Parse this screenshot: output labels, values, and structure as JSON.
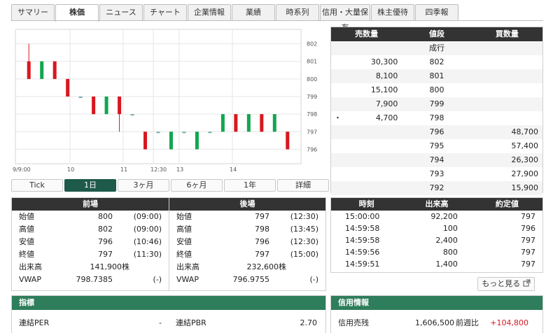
{
  "tabs": [
    "サマリー",
    "株価",
    "ニュース",
    "チャート",
    "企業情報",
    "業績",
    "時系列",
    "信用・大量保有",
    "株主優待",
    "四季報"
  ],
  "active_tab": "株価",
  "chart_data": {
    "type": "candlestick",
    "y_ticks": [
      "802",
      "801",
      "800",
      "799",
      "798",
      "797",
      "796"
    ],
    "ylim": [
      795.5,
      802.5
    ],
    "x_labels": [
      "9/9:00",
      "10",
      "11",
      "12:30",
      "13",
      "14"
    ],
    "up_color": "#12a650",
    "down_color": "#d8171f",
    "candles": [
      {
        "o": 801,
        "c": 800,
        "h": 802,
        "l": 800
      },
      {
        "o": 800,
        "c": 801,
        "h": 801,
        "l": 800
      },
      {
        "o": 801,
        "c": 800,
        "h": 801,
        "l": 800
      },
      {
        "o": 800,
        "c": 799,
        "h": 800,
        "l": 799
      },
      {
        "o": 799,
        "c": 799,
        "h": 799,
        "l": 799
      },
      {
        "o": 799,
        "c": 798,
        "h": 799,
        "l": 798
      },
      {
        "o": 798,
        "c": 799,
        "h": 799,
        "l": 798
      },
      {
        "o": 799,
        "c": 798,
        "h": 799,
        "l": 797
      },
      {
        "o": 798,
        "c": 798,
        "h": 798,
        "l": 798
      },
      {
        "o": 797,
        "c": 796,
        "h": 797,
        "l": 796
      },
      {
        "o": 797,
        "c": 797,
        "h": 797,
        "l": 797
      },
      {
        "o": 796,
        "c": 797,
        "h": 797,
        "l": 796
      },
      {
        "o": 797,
        "c": 797,
        "h": 797,
        "l": 797
      },
      {
        "o": 796,
        "c": 797,
        "h": 797,
        "l": 796
      },
      {
        "o": 797,
        "c": 797,
        "h": 797,
        "l": 797
      },
      {
        "o": 797,
        "c": 798,
        "h": 798,
        "l": 797
      },
      {
        "o": 798,
        "c": 797,
        "h": 798,
        "l": 797
      },
      {
        "o": 797,
        "c": 798,
        "h": 798,
        "l": 797
      },
      {
        "o": 798,
        "c": 797,
        "h": 798,
        "l": 797
      },
      {
        "o": 797,
        "c": 798,
        "h": 798,
        "l": 797
      },
      {
        "o": 797,
        "c": 796,
        "h": 797,
        "l": 796
      }
    ]
  },
  "ranges": [
    "Tick",
    "1日",
    "3ヶ月",
    "6ヶ月",
    "1年",
    "詳細"
  ],
  "active_range": "1日",
  "session": {
    "morning": {
      "title": "前場",
      "rows": [
        {
          "label": "始値",
          "value": "800",
          "time": "(09:00)"
        },
        {
          "label": "高値",
          "value": "802",
          "time": "(09:00)"
        },
        {
          "label": "安値",
          "value": "796",
          "time": "(10:46)"
        },
        {
          "label": "終値",
          "value": "797",
          "time": "(11:30)"
        },
        {
          "label": "出来高",
          "value": "141,900株",
          "time": ""
        },
        {
          "label": "VWAP",
          "value": "798.7385",
          "time": "(-)"
        }
      ]
    },
    "afternoon": {
      "title": "後場",
      "rows": [
        {
          "label": "始値",
          "value": "797",
          "time": "(12:30)"
        },
        {
          "label": "高値",
          "value": "798",
          "time": "(13:45)"
        },
        {
          "label": "安値",
          "value": "796",
          "time": "(12:30)"
        },
        {
          "label": "終値",
          "value": "797",
          "time": "(15:00)"
        },
        {
          "label": "出来高",
          "value": "232,600株",
          "time": ""
        },
        {
          "label": "VWAP",
          "value": "796.9755",
          "time": "(-)"
        }
      ]
    }
  },
  "board": {
    "headers": [
      "売数量",
      "値段",
      "買数量"
    ],
    "rows": [
      {
        "sell": "",
        "price": "成行",
        "buy": "",
        "mark": ""
      },
      {
        "sell": "30,300",
        "price": "802",
        "buy": "",
        "mark": ""
      },
      {
        "sell": "8,100",
        "price": "801",
        "buy": "",
        "mark": ""
      },
      {
        "sell": "15,100",
        "price": "800",
        "buy": "",
        "mark": ""
      },
      {
        "sell": "7,900",
        "price": "799",
        "buy": "",
        "mark": ""
      },
      {
        "sell": "4,700",
        "price": "798",
        "buy": "",
        "mark": "・"
      },
      {
        "sell": "",
        "price": "796",
        "buy": "48,700",
        "mark": ""
      },
      {
        "sell": "",
        "price": "795",
        "buy": "57,400",
        "mark": ""
      },
      {
        "sell": "",
        "price": "794",
        "buy": "26,300",
        "mark": ""
      },
      {
        "sell": "",
        "price": "793",
        "buy": "27,900",
        "mark": ""
      },
      {
        "sell": "",
        "price": "792",
        "buy": "15,900",
        "mark": ""
      }
    ]
  },
  "ticks": {
    "headers": [
      "時刻",
      "出来高",
      "約定値"
    ],
    "rows": [
      {
        "time": "15:00:00",
        "volume": "92,200",
        "price": "797"
      },
      {
        "time": "14:59:58",
        "volume": "100",
        "price": "796"
      },
      {
        "time": "14:59:58",
        "volume": "2,400",
        "price": "797"
      },
      {
        "time": "14:59:56",
        "volume": "800",
        "price": "797"
      },
      {
        "time": "14:59:51",
        "volume": "1,400",
        "price": "797"
      }
    ],
    "more_label": "もっと見る"
  },
  "indicators": {
    "title": "指標",
    "per_label": "連結PER",
    "per_value": "-",
    "pbr_label": "連結PBR",
    "pbr_value": "2.70"
  },
  "credit": {
    "title": "信用情報",
    "label": "信用売残",
    "value": "1,606,500",
    "change_label": "前週比",
    "change_value": "+104,800",
    "change_color": "#d8171f"
  }
}
